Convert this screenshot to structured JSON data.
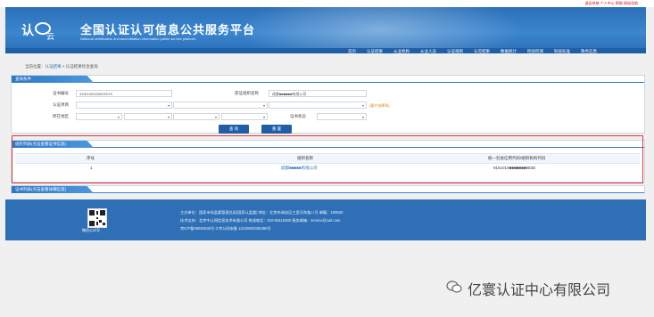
{
  "topbar": {
    "links": "退出系统  个人中心  帮助  网站导航"
  },
  "header": {
    "title_cn": "全国认证认可信息公共服务平台",
    "title_en": "National certification and accreditation information public service platform"
  },
  "nav": [
    "首页",
    "认证结果",
    "从业机构",
    "从业人员",
    "认证规则",
    "认可结果",
    "数据统计",
    "检验检测",
    "科技标准",
    "政务信息"
  ],
  "breadcrumb": {
    "prefix": "当前位置：",
    "link": "认证结果",
    "sep": " > ",
    "current": "认证结果综合查询"
  },
  "query_panel": {
    "title": "查询条件",
    "cert_no_label": "证书编号",
    "cert_no_value": "4331100000IIIOROS",
    "org_name_label": "获证组织名称",
    "org_name_value": "成都■■■■■■有限公司",
    "project_label": "认证项目",
    "project_hint": "(客户选择项)",
    "region_label": "所在地区",
    "status_label": "证书状态",
    "query_btn": "查 询",
    "reset_btn": "重 置"
  },
  "org_panel": {
    "title": "组织列表(点击查看证书信息)",
    "columns": [
      "序号",
      "组织名称",
      "统一社会信用代码/组织机构代码"
    ],
    "rows": [
      {
        "no": "1",
        "name": "成都■■■■■有限公司",
        "code": "9151010■■■■■■■983D"
      }
    ]
  },
  "cert_panel": {
    "title": "证书列表(点击查看详细信息)"
  },
  "footer": {
    "qr_caption": "微信公众号",
    "line1": "主办单位：国家市场监督管理总局(国家认监委)    地址：北京市海淀区三里河东路八号    邮编：100820",
    "line2": "技术支持：北京中认网信息技术有限公司    热线电话：010-59116300    服务邮箱：service@cait.com",
    "line3": "京ICP备09062530号-3    京公网安备 11010502035380号"
  },
  "watermark": "亿寰认证中心有限公司"
}
